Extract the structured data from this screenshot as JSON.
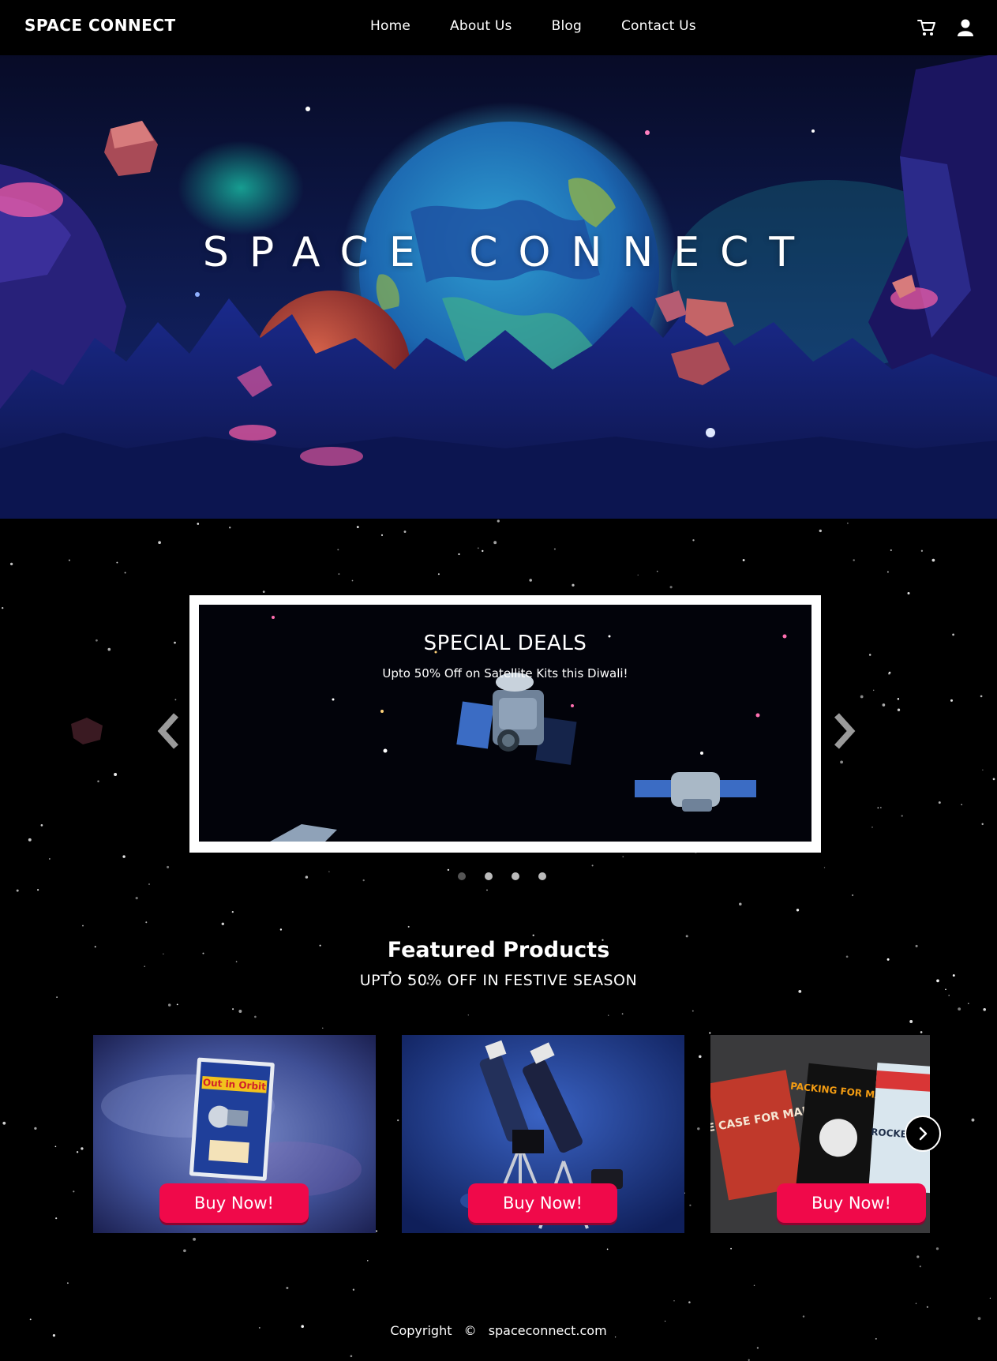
{
  "nav": {
    "brand": "SPACE CONNECT",
    "links": [
      "Home",
      "About Us",
      "Blog",
      "Contact Us"
    ],
    "icons": [
      "cart-icon",
      "user-icon"
    ]
  },
  "hero": {
    "title": "SPACE CONNECT"
  },
  "carousel": {
    "slide_title": "SPECIAL DEALS",
    "slide_subtitle": "Upto 50% Off on Satellite Kits this Diwali!",
    "slide_count": 4,
    "active_index": 0,
    "prev_icon": "chevron-left-icon",
    "next_icon": "chevron-right-icon"
  },
  "featured": {
    "title": "Featured Products",
    "subtitle": "UPTO 50% OFF IN FESTIVE SEASON",
    "products": [
      {
        "image": "satellite-kit-box",
        "box_label": "Out in Orbit",
        "button": "Buy Now!"
      },
      {
        "image": "telescopes",
        "button": "Buy Now!"
      },
      {
        "image": "space-books",
        "book_titles": [
          "THE CASE FOR MARS",
          "PACKING FOR MARS",
          "ROCKET MEN"
        ],
        "button": "Buy Now!"
      }
    ],
    "next_icon": "chevron-right-icon"
  },
  "footer": {
    "copyright_label": "Copyright",
    "symbol": "©",
    "domain": "spaceconnect.com"
  },
  "colors": {
    "background": "#000000",
    "accent": "#f0094a",
    "text": "#ffffff"
  }
}
